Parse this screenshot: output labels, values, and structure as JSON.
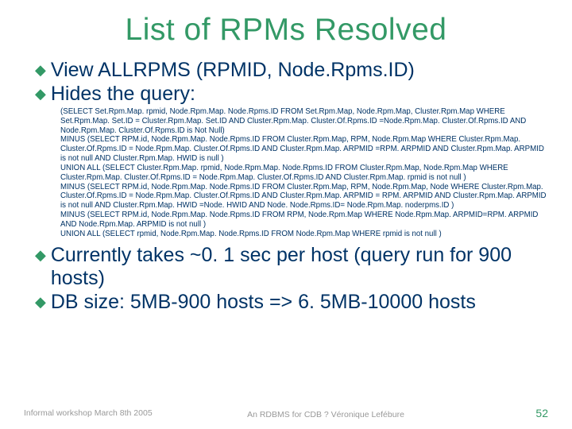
{
  "title": "List of RPMs Resolved",
  "bullets": [
    "View ALLRPMS (RPMID, Node.Rpms.ID)",
    "Hides the query:"
  ],
  "sql": "(SELECT Set.Rpm.Map. rpmid, Node.Rpm.Map. Node.Rpms.ID     FROM Set.Rpm.Map, Node.Rpm.Map, Cluster.Rpm.Map     WHERE Set.Rpm.Map. Set.ID = Cluster.Rpm.Map. Set.ID     AND Cluster.Rpm.Map. Cluster.Of.Rpms.ID =Node.Rpm.Map. Cluster.Of.Rpms.ID                 AND Node.Rpm.Map. Cluster.Of.Rpms.ID is Not Null)\nMINUS (SELECT RPM.id, Node.Rpm.Map. Node.Rpms.ID     FROM Cluster.Rpm.Map, RPM, Node.Rpm.Map     WHERE Cluster.Rpm.Map. Cluster.Of.Rpms.ID = Node.Rpm.Map. Cluster.Of.Rpms.ID    AND Cluster.Rpm.Map. ARPMID =RPM. ARPMID     AND Cluster.Rpm.Map. ARPMID is not null    AND Cluster.Rpm.Map. HWID is null )\nUNION ALL (SELECT Cluster.Rpm.Map. rpmid, Node.Rpm.Map. Node.Rpms.ID     FROM Cluster.Rpm.Map, Node.Rpm.Map    WHERE Cluster.Rpm.Map. Cluster.Of.Rpms.ID = Node.Rpm.Map. Cluster.Of.Rpms.ID    AND Cluster.Rpm.Map. rpmid is not null )\nMINUS (SELECT RPM.id, Node.Rpm.Map. Node.Rpms.ID     FROM Cluster.Rpm.Map, RPM, Node.Rpm.Map, Node     WHERE Cluster.Rpm.Map. Cluster.Of.Rpms.ID = Node.Rpm.Map. Cluster.Of.Rpms.ID AND Cluster.Rpm.Map. ARPMID = RPM. ARPMID     AND Cluster.Rpm.Map. ARPMID is not null    AND Cluster.Rpm.Map. HWID =Node. HWID     AND Node. Node.Rpms.ID= Node.Rpm.Map. noderpms.ID )\nMINUS (SELECT RPM.id, Node.Rpm.Map. Node.Rpms.ID     FROM RPM, Node.Rpm.Map     WHERE Node.Rpm.Map. ARPMID=RPM. ARPMID     AND Node.Rpm.Map. ARPMID is not null )\nUNION ALL (SELECT rpmid, Node.Rpm.Map. Node.Rpms.ID     FROM Node.Rpm.Map    WHERE rpmid is not null )",
  "bullets2": [
    "Currently takes ~0. 1 sec per host (query run for 900 hosts)",
    "DB size: 5MB-900 hosts => 6. 5MB-10000 hosts"
  ],
  "footer": {
    "left": "Informal workshop March 8th 2005",
    "center": "An RDBMS for CDB ? Véronique Lefébure",
    "page": "52"
  }
}
